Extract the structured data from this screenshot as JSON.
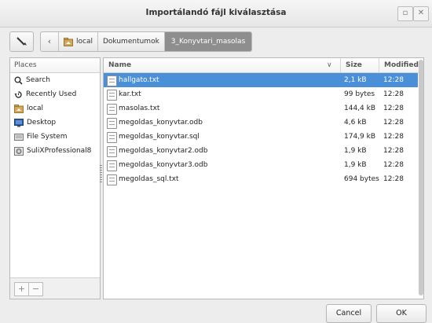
{
  "window": {
    "title": "Importálandó fájl kiválasztása",
    "minimize_glyph": "▫",
    "close_glyph": "✕"
  },
  "pathbar": {
    "back_glyph": "‹",
    "segments": [
      "local",
      "Dokumentumok",
      "3_Konyvtari_masolas"
    ]
  },
  "places": {
    "header": "Places",
    "items": [
      {
        "label": "Search",
        "icon": "search-icon"
      },
      {
        "label": "Recently Used",
        "icon": "clock-icon"
      },
      {
        "label": "local",
        "icon": "home-folder-icon"
      },
      {
        "label": "Desktop",
        "icon": "desktop-icon"
      },
      {
        "label": "File System",
        "icon": "drive-icon"
      },
      {
        "label": "SuliXProfessional8",
        "icon": "disc-icon"
      }
    ],
    "add_glyph": "+",
    "remove_glyph": "−"
  },
  "filelist": {
    "columns": {
      "name": "Name",
      "size": "Size",
      "modified": "Modified"
    },
    "sort_glyph": "∨",
    "files": [
      {
        "name": "hallgato.txt",
        "size": "2,1 kB",
        "modified": "12:28",
        "selected": true
      },
      {
        "name": "kar.txt",
        "size": "99 bytes",
        "modified": "12:28"
      },
      {
        "name": "masolas.txt",
        "size": "144,4 kB",
        "modified": "12:28"
      },
      {
        "name": "megoldas_konyvtar.odb",
        "size": "4,6 kB",
        "modified": "12:28"
      },
      {
        "name": "megoldas_konyvtar.sql",
        "size": "174,9 kB",
        "modified": "12:28"
      },
      {
        "name": "megoldas_konyvtar2.odb",
        "size": "1,9 kB",
        "modified": "12:28"
      },
      {
        "name": "megoldas_konyvtar3.odb",
        "size": "1,9 kB",
        "modified": "12:28"
      },
      {
        "name": "megoldas_sql.txt",
        "size": "694 bytes",
        "modified": "12:28"
      }
    ]
  },
  "buttons": {
    "cancel": "Cancel",
    "ok": "OK"
  },
  "colors": {
    "selection": "#4a90d9",
    "active_path": "#8e8e8e"
  }
}
